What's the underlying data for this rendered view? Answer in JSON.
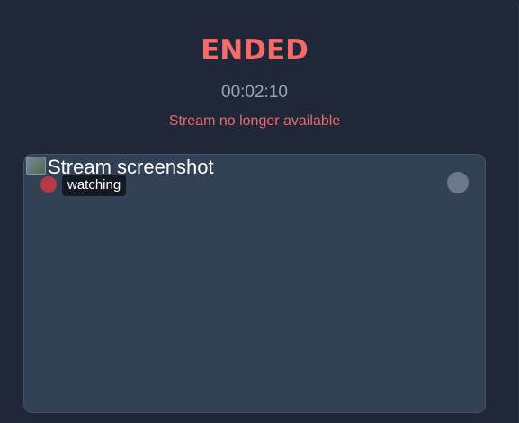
{
  "stream": {
    "status": "ENDED",
    "elapsed": "00:02:10",
    "message": "Stream no longer available"
  },
  "card": {
    "image_alt": "Stream screenshot",
    "viewer_label": "watching"
  },
  "colors": {
    "background": "#1f2739",
    "status_red": "#f36b6b",
    "card_bg": "#334155",
    "recording_dot": "#b53a45",
    "indicator_gray": "#6b778c"
  }
}
